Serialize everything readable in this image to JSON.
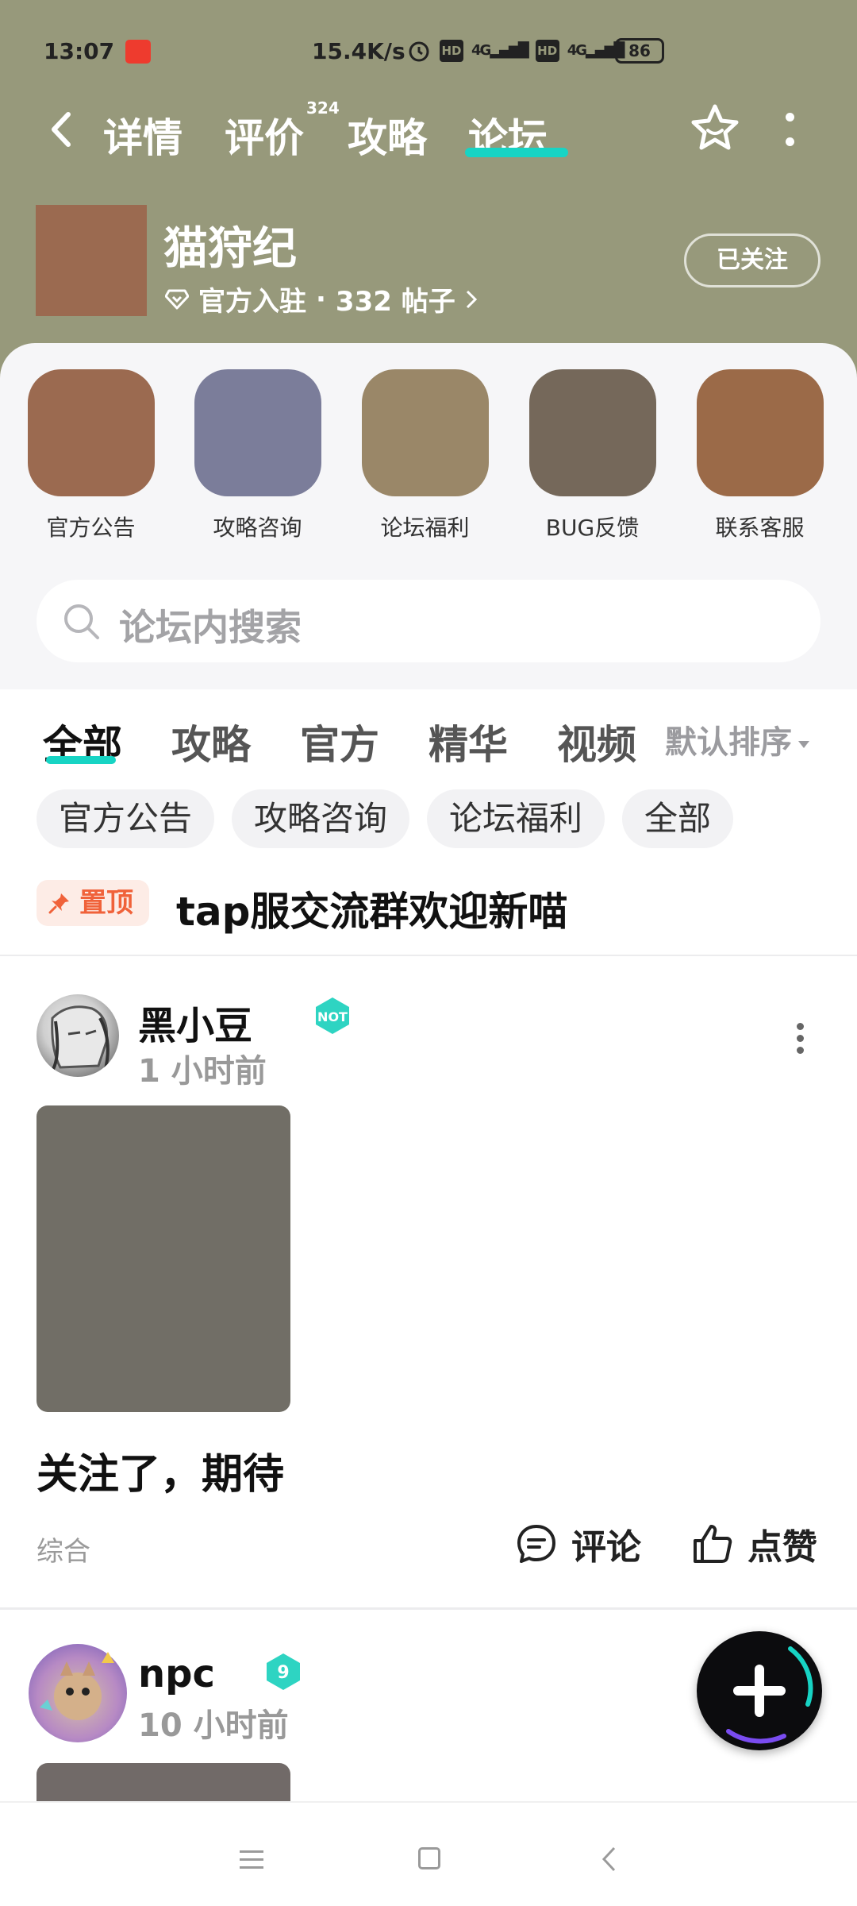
{
  "status_bar": {
    "time": "13:07",
    "speed": "15.4K/s",
    "network_labels": [
      "HD",
      "4G",
      "HD",
      "4G"
    ],
    "battery": "86"
  },
  "nav": {
    "tabs": [
      {
        "label": "详情"
      },
      {
        "label": "评价",
        "badge": "324"
      },
      {
        "label": "攻略"
      },
      {
        "label": "论坛",
        "active": true
      }
    ]
  },
  "game": {
    "name": "猫狩纪",
    "official": "官方入驻",
    "separator": "·",
    "posts": "332 帖子",
    "follow_label": "已关注"
  },
  "categories": [
    {
      "label": "官方公告",
      "color": "#9b6a50"
    },
    {
      "label": "攻略咨询",
      "color": "#7b7d9a"
    },
    {
      "label": "论坛福利",
      "color": "#9a8768"
    },
    {
      "label": "BUG反馈",
      "color": "#75685a"
    },
    {
      "label": "联系客服",
      "color": "#9b6a48"
    }
  ],
  "search": {
    "placeholder": "论坛内搜索"
  },
  "filter_tabs": [
    "全部",
    "攻略",
    "官方",
    "精华",
    "视频"
  ],
  "sort_label": "默认排序",
  "chips": [
    "官方公告",
    "攻略咨询",
    "论坛福利",
    "全部"
  ],
  "pinned": {
    "tag": "置顶",
    "title": "tap服交流群欢迎新喵"
  },
  "posts": [
    {
      "author": "黑小豆",
      "time": "1 小时前",
      "text": "关注了，期待",
      "category": "综合",
      "comment_label": "评论",
      "like_label": "点赞"
    },
    {
      "author": "npc",
      "time": "10 小时前"
    }
  ],
  "colors": {
    "header_bg": "#97997b",
    "accent": "#17d4c4",
    "pin_tag": "#f0623a"
  }
}
